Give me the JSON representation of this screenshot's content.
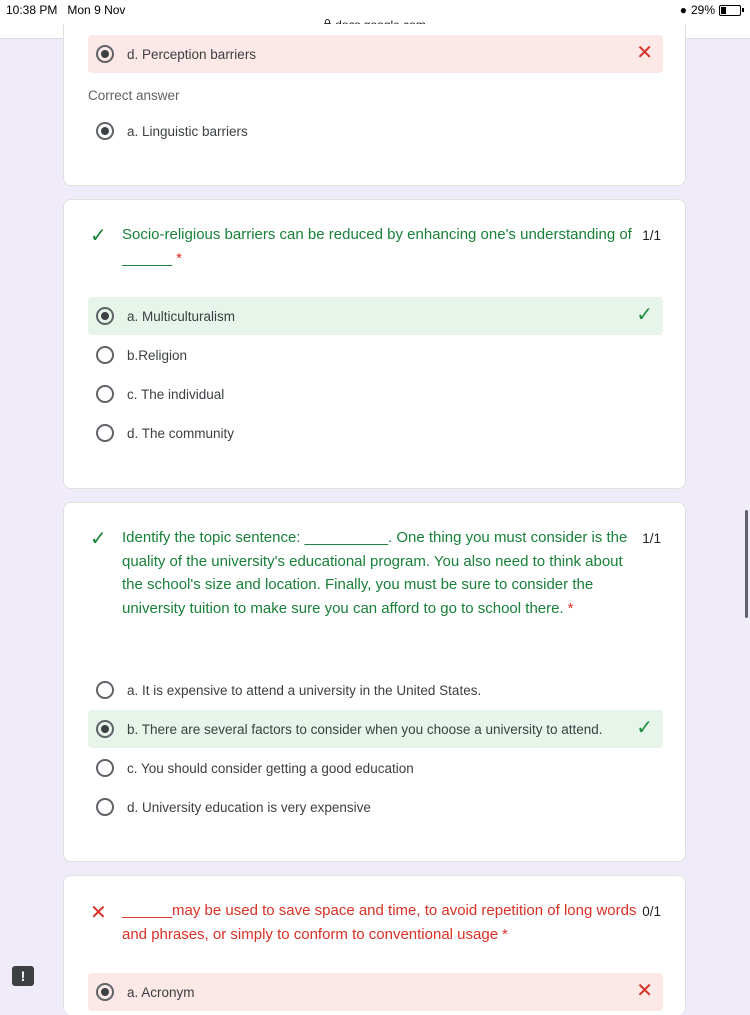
{
  "status": {
    "time": "10:38 PM",
    "date": "Mon 9 Nov",
    "battery": "29%",
    "url": "docs.google.com"
  },
  "q0": {
    "selected_option": "d. Perception barriers",
    "correct_label": "Correct answer",
    "correct_option": "a. Linguistic barriers"
  },
  "q1": {
    "text": "Socio-religious barriers can be reduced by enhancing one's understanding of ______",
    "required": "*",
    "score": "1/1",
    "options": [
      "a. Multiculturalism",
      "b.Religion",
      "c. The individual",
      "d. The community"
    ]
  },
  "q2": {
    "text": "Identify the topic sentence: __________. One thing you must consider is the quality of the university's educational program. You also need to think about the school's size and location. Finally, you must be sure to consider the university tuition to make sure you can afford to go to school there.",
    "required": "*",
    "score": "1/1",
    "options": [
      "a. It is expensive to attend a university in the United States.",
      "b. There are several factors to consider when you choose a university to attend.",
      "c. You should consider getting a good education",
      "d. University education is very expensive"
    ]
  },
  "q3": {
    "text": "______may be used to save space and time, to avoid repetition of long words and phrases, or simply to conform to conventional usage",
    "required": "*",
    "score": "0/1",
    "options": [
      "a. Acronym"
    ]
  },
  "colors": {
    "correct": "#188038",
    "wrong": "#d93025",
    "background": "#f0ebf8"
  },
  "icons": [
    "lock-icon",
    "wifi-icon",
    "battery-icon",
    "check-icon",
    "close-icon",
    "feedback-icon"
  ]
}
